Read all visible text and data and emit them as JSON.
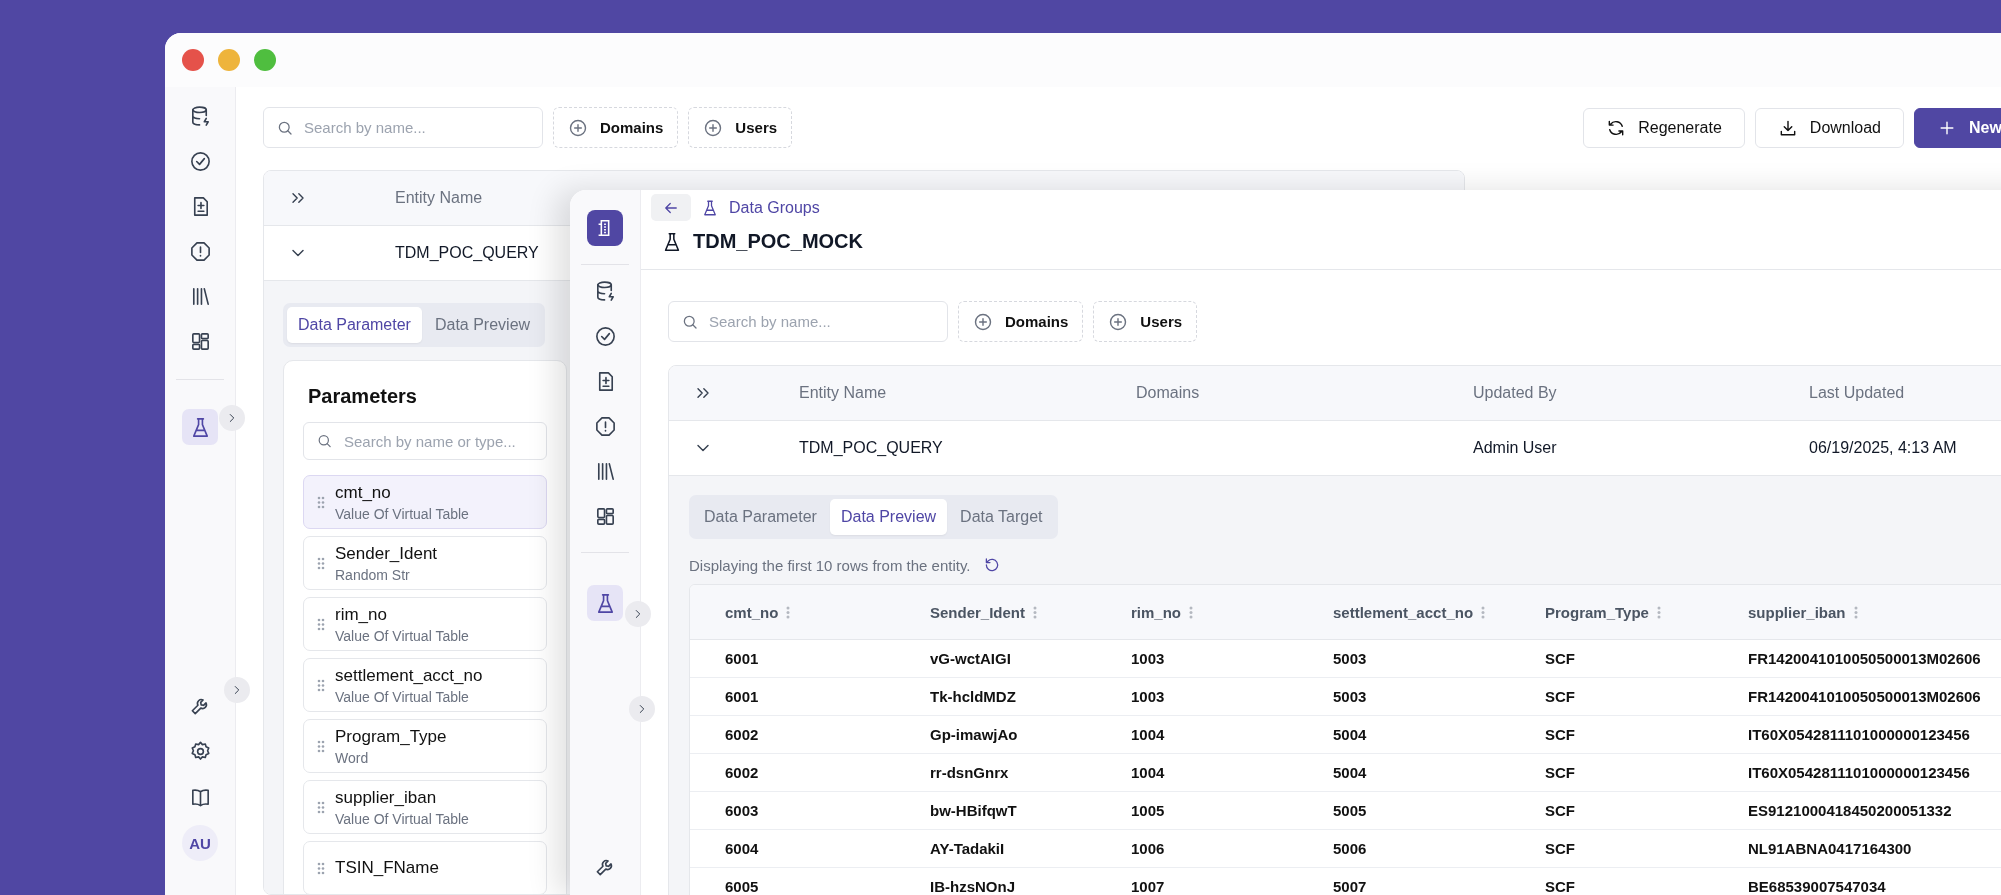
{
  "back_app": {
    "sidebar": {
      "top": [
        {
          "kind": "database",
          "selected": false
        },
        {
          "kind": "check",
          "selected": false
        },
        {
          "kind": "file",
          "selected": false
        },
        {
          "kind": "alert",
          "selected": false
        },
        {
          "kind": "library",
          "selected": false
        },
        {
          "kind": "grid",
          "selected": false
        }
      ],
      "middle": [
        {
          "kind": "flask",
          "selected": true
        }
      ],
      "bottom": [
        {
          "kind": "wrench",
          "selected": false
        },
        {
          "kind": "settings",
          "selected": false
        },
        {
          "kind": "book",
          "selected": false
        }
      ],
      "avatar": "AU"
    },
    "search": {
      "placeholder": "Search by name..."
    },
    "filters": [
      "Domains",
      "Users"
    ],
    "actions": [
      {
        "label": "Regenerate",
        "kind": "regenerate"
      },
      {
        "label": "Download",
        "kind": "download"
      },
      {
        "label": "New",
        "kind": "primary"
      }
    ],
    "table": {
      "columns": [
        "Entity Name"
      ],
      "rows": [
        {
          "entity_name": "TDM_POC_QUERY",
          "expanded": true
        }
      ]
    },
    "tabs": [
      {
        "label": "Data Parameter",
        "selected": true
      },
      {
        "label": "Data Preview",
        "selected": false
      }
    ],
    "parameters": {
      "title": "Parameters",
      "search": {
        "placeholder": "Search by name or type..."
      },
      "items": [
        {
          "name": "cmt_no",
          "type": "Value Of Virtual Table",
          "selected": true
        },
        {
          "name": "Sender_Ident",
          "type": "Random Str",
          "selected": false
        },
        {
          "name": "rim_no",
          "type": "Value Of Virtual Table",
          "selected": false
        },
        {
          "name": "settlement_acct_no",
          "type": "Value Of Virtual Table",
          "selected": false
        },
        {
          "name": "Program_Type",
          "type": "Word",
          "selected": false
        },
        {
          "name": "supplier_iban",
          "type": "Value Of Virtual Table",
          "selected": false
        },
        {
          "name": "TSIN_FName",
          "selected": false
        }
      ]
    }
  },
  "front_app": {
    "sidebar": {
      "top": [
        {
          "kind": "database",
          "selected": false
        },
        {
          "kind": "check",
          "selected": false
        },
        {
          "kind": "file",
          "selected": false
        },
        {
          "kind": "alert",
          "selected": false
        },
        {
          "kind": "library",
          "selected": false
        },
        {
          "kind": "grid",
          "selected": false
        }
      ],
      "middle": [
        {
          "kind": "flask",
          "selected": true
        }
      ],
      "bottom": [
        {
          "kind": "wrench",
          "selected": false
        }
      ]
    },
    "breadcrumb": "Data Groups",
    "title": "TDM_POC_MOCK",
    "search": {
      "placeholder": "Search by name..."
    },
    "filters": [
      "Domains",
      "Users"
    ],
    "table": {
      "columns": [
        "Entity Name",
        "Domains",
        "Updated By",
        "Last Updated"
      ],
      "rows": [
        {
          "entity_name": "TDM_POC_QUERY",
          "updated_by": "Admin User",
          "last_updated": "06/19/2025, 4:13 AM",
          "expanded": true
        }
      ]
    },
    "tabs": [
      {
        "label": "Data Parameter",
        "selected": false
      },
      {
        "label": "Data Preview",
        "selected": true
      },
      {
        "label": "Data Target",
        "selected": false
      }
    ],
    "preview": {
      "caption": "Displaying the first 10 rows from the entity.",
      "columns": [
        "cmt_no",
        "Sender_Ident",
        "rim_no",
        "settlement_acct_no",
        "Program_Type",
        "supplier_iban"
      ],
      "rows": [
        [
          "6001",
          "vG-wctAIGI",
          "1003",
          "5003",
          "SCF",
          "FR1420041010050500013M02606"
        ],
        [
          "6001",
          "Tk-hcldMDZ",
          "1003",
          "5003",
          "SCF",
          "FR1420041010050500013M02606"
        ],
        [
          "6002",
          "Gp-imawjAo",
          "1004",
          "5004",
          "SCF",
          "IT60X0542811101000000123456"
        ],
        [
          "6002",
          "rr-dsnGnrx",
          "1004",
          "5004",
          "SCF",
          "IT60X0542811101000000123456"
        ],
        [
          "6003",
          "bw-HBifqwT",
          "1005",
          "5005",
          "SCF",
          "ES9121000418450200051332"
        ],
        [
          "6004",
          "AY-TadakiI",
          "1006",
          "5006",
          "SCF",
          "NL91ABNA0417164300"
        ],
        [
          "6005",
          "IB-hzsNOnJ",
          "1007",
          "5007",
          "SCF",
          "BE68539007547034"
        ]
      ]
    }
  }
}
